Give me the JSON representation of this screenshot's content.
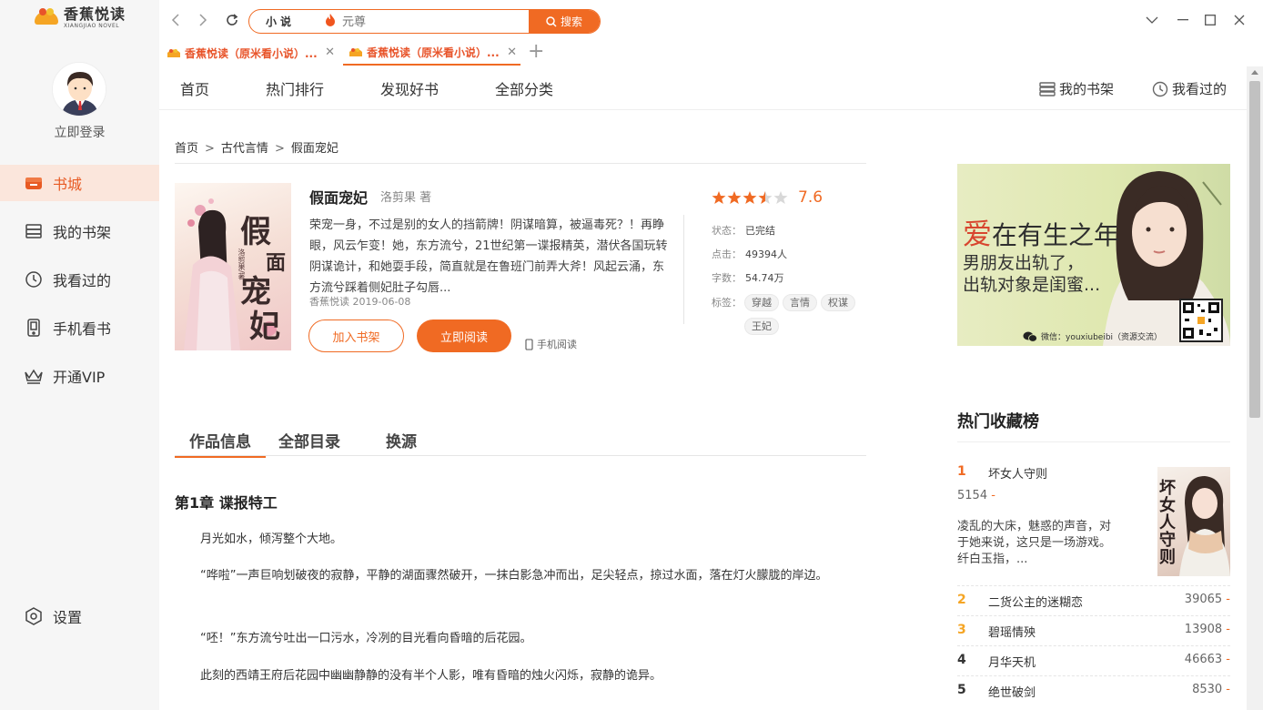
{
  "sidebar": {
    "logo_cn": "香蕉悦读",
    "logo_en": "XIANGJIAO NOVEL",
    "login": "立即登录",
    "items": [
      {
        "label": "书城",
        "icon": "bookstore-icon"
      },
      {
        "label": "我的书架",
        "icon": "bookshelf-icon"
      },
      {
        "label": "我看过的",
        "icon": "clock-icon"
      },
      {
        "label": "手机看书",
        "icon": "phone-icon"
      },
      {
        "label": "开通VIP",
        "icon": "crown-icon"
      }
    ],
    "settings": "设置"
  },
  "search": {
    "category": "小说",
    "placeholder": "元尊",
    "button": "搜索"
  },
  "tabs": [
    {
      "label": "香蕉悦读（原米看小说）..."
    },
    {
      "label": "香蕉悦读（原米看小说）..."
    }
  ],
  "mainnav": {
    "items": [
      "首页",
      "热门排行",
      "发现好书",
      "全部分类"
    ],
    "bookshelf": "我的书架",
    "history": "我看过的"
  },
  "breadcrumb": [
    "首页",
    "古代言情",
    "假面宠妃"
  ],
  "book": {
    "title": "假面宠妃",
    "author": "洛剪果 著",
    "desc": "荣宠一身，不过是别的女人的挡箭牌！阴谋暗算，被逼毒死？！再睁眼，风云乍变！她，东方流兮，21世纪第一谍报精英，潜伏各国玩转阴谋诡计，和她耍手段，简直就是在鲁班门前弄大斧！风起云涌，东方流兮踩着侧妃肚子勾唇...",
    "meta": "香蕉悦读 2019-06-08",
    "add_btn": "加入书架",
    "read_btn": "立即阅读",
    "phone_read": "手机阅读",
    "rating": "7.6",
    "rating_stars": 3.5,
    "status_label": "状态：",
    "status": "已完结",
    "clicks_label": "点击：",
    "clicks": "49394人",
    "words_label": "字数：",
    "words": "54.74万",
    "tags_label": "标签：",
    "tags": [
      "穿越",
      "言情",
      "权谋",
      "王妃"
    ],
    "cover_text": [
      "假",
      "面",
      "宠",
      "妃"
    ],
    "cover_author": "洛剪果/著"
  },
  "content_tabs": [
    "作品信息",
    "全部目录",
    "换源"
  ],
  "chapter": {
    "title": "第1章 谍报特工",
    "paras": [
      "月光如水，倾泻整个大地。",
      "“哗啦”一声巨响划破夜的寂静，平静的湖面骤然破开，一抹白影急冲而出，足尖轻点，掠过水面，落在灯火朦胧的岸边。",
      "“呸！”东方流兮吐出一口污水，冷冽的目光看向昏暗的后花园。",
      "此刻的西靖王府后花园中幽幽静静的没有半个人影，唯有昏暗的烛火闪烁，寂静的诡异。"
    ]
  },
  "banner": {
    "line1_ai": "爱",
    "line1_rest": "在有生之年",
    "line2": "男朋友出轨了，",
    "line3": "出轨对象是闺蜜...",
    "wechat": "微信：youxiubeibi（资源交流）"
  },
  "hot": {
    "title": "热门收藏榜",
    "first": {
      "rank": "1",
      "name": "坏女人守则",
      "count": "5154",
      "desc": "凌乱的大床，魅惑的声音，对于她来说，这只是一场游戏。纤白玉指，...",
      "cover_text": "坏女人守则"
    },
    "items": [
      {
        "rank": "2",
        "name": "二货公主的迷糊恋",
        "count": "39065"
      },
      {
        "rank": "3",
        "name": "碧瑶情殃",
        "count": "13908"
      },
      {
        "rank": "4",
        "name": "月华天机",
        "count": "46663"
      },
      {
        "rank": "5",
        "name": "绝世破剑",
        "count": "8530"
      }
    ],
    "dash": "-"
  },
  "colors": {
    "accent": "#f06a23",
    "rank1": "#f06a23",
    "rank2": "#f5a524",
    "rank3": "#f5a524"
  }
}
